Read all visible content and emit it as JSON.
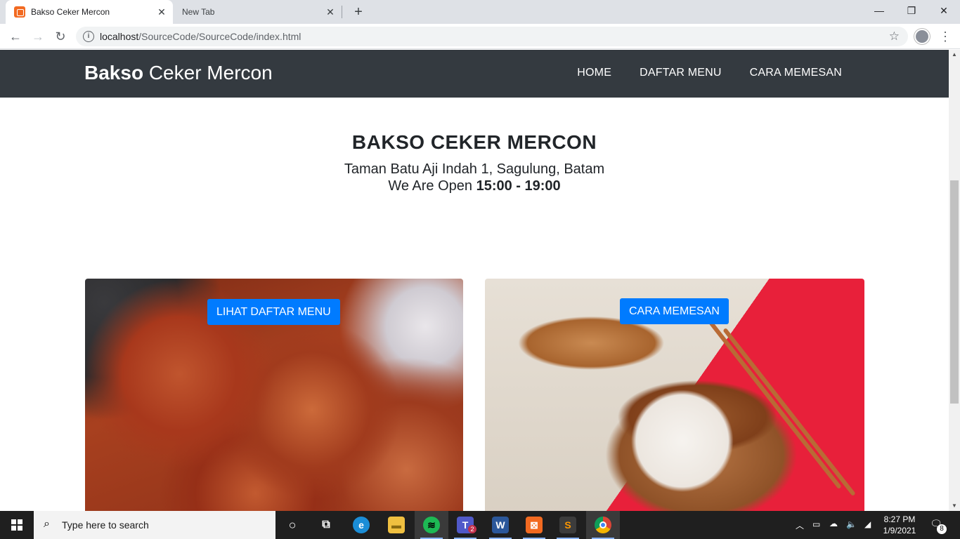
{
  "browser": {
    "tabs": [
      {
        "title": "Bakso Ceker Mercon",
        "active": true
      },
      {
        "title": "New Tab",
        "active": false
      }
    ],
    "new_tab_icon": "plus-icon",
    "url_host": "localhost",
    "url_path": "/SourceCode/SourceCode/index.html",
    "window_controls": {
      "minimize": "—",
      "restore": "❐",
      "close": "✕"
    }
  },
  "site": {
    "brand_bold": "Bakso",
    "brand_rest": " Ceker Mercon",
    "nav": [
      {
        "label": "HOME"
      },
      {
        "label": "DAFTAR MENU"
      },
      {
        "label": "CARA MEMESAN"
      }
    ],
    "hero": {
      "title": "BAKSO CEKER MERCON",
      "address": "Taman Batu Aji Indah 1, Sagulung, Batam",
      "open_prefix": "We Are Open ",
      "open_hours": "15:00 - 19:00"
    },
    "cards": [
      {
        "button": "LIHAT DAFTAR MENU",
        "image": "spicy-meatballs-photo"
      },
      {
        "button": "CARA MEMESAN",
        "image": "chicken-feet-dimsum-photo"
      }
    ]
  },
  "taskbar": {
    "search_placeholder": "Type here to search",
    "time": "8:27 PM",
    "date": "1/9/2021",
    "notification_count": "8",
    "teams_badge": "2"
  },
  "colors": {
    "navbar": "#343a40",
    "button": "#007bff",
    "text": "#212529"
  }
}
